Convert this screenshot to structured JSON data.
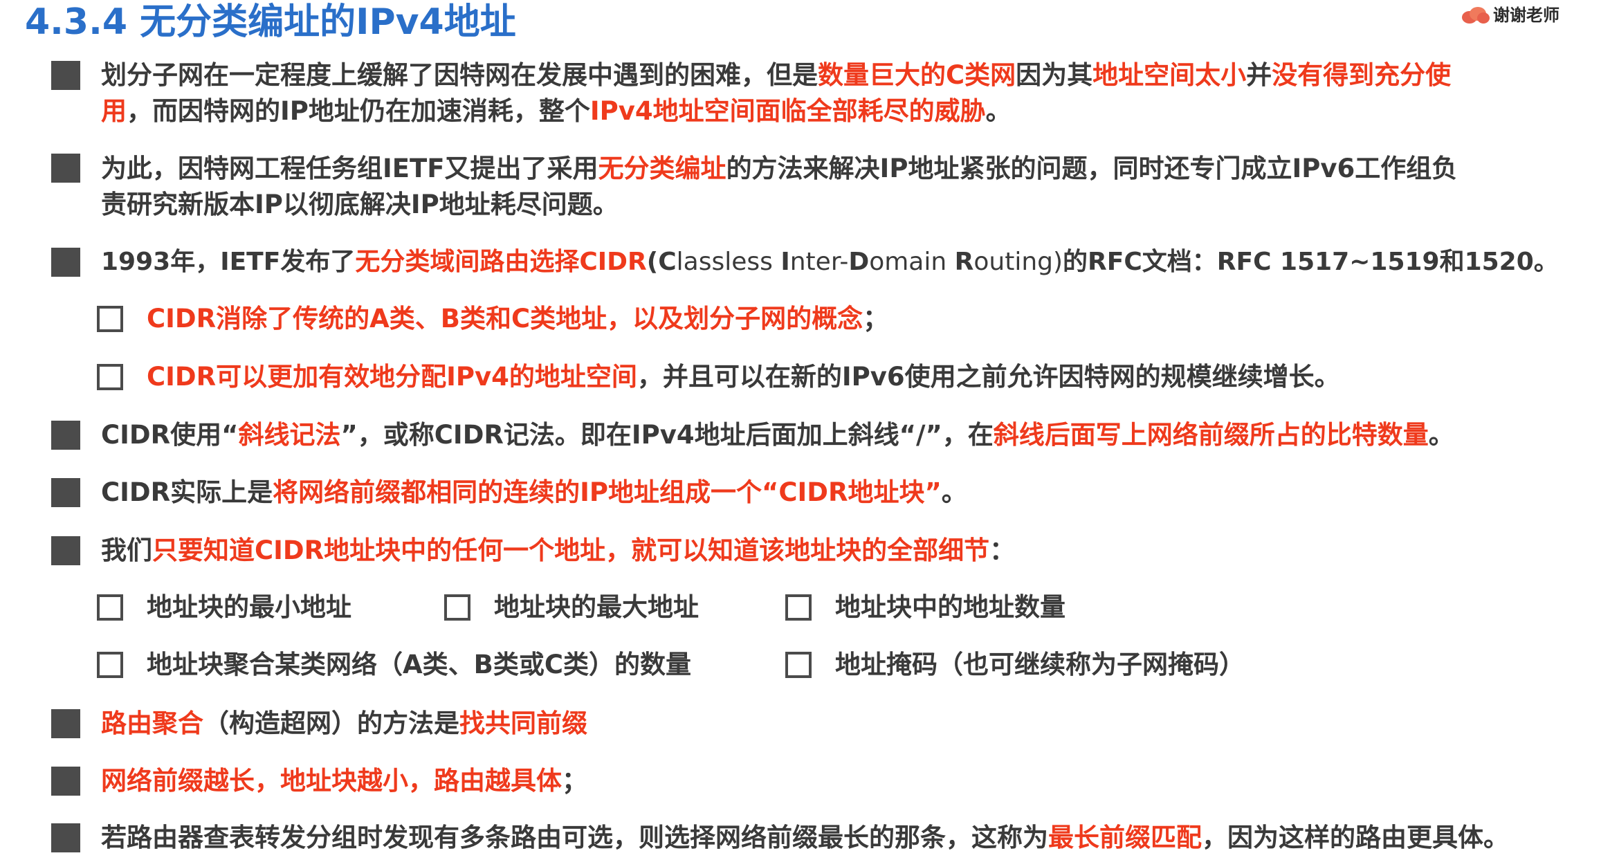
{
  "title": "4.3.4 无分类编址的IPv4地址",
  "logo": "谢谢老师",
  "b1": {
    "l1": [
      "划分子网在一定程度上缓解了因特网在发展中遇到的困难，但是",
      "数量巨大的C类网",
      "因为其",
      "地址空间太小",
      "并",
      "没有得到充分使"
    ],
    "l2": [
      "用",
      "，而因特网的IP地址仍在加速消耗，整个",
      "IPv4地址空间面临全部耗尽的威胁",
      "。"
    ]
  },
  "b2": {
    "l1": [
      "为此，因特网工程任务组IETF又提出了采用",
      "无分类编址",
      "的方法来解决IP地址紧张的问题，同时还专门成立IPv6工作组负"
    ],
    "l2": [
      "责研究新版本IP以彻底解决IP地址耗尽问题。"
    ]
  },
  "b3": [
    "1993年，IETF发布了",
    "无分类域间路由选择CIDR",
    "(",
    "C",
    "lassless ",
    "I",
    "nter-",
    "D",
    "omain ",
    "R",
    "outing)",
    "的RFC文档：RFC 1517~1519和1520。"
  ],
  "s1": [
    "CIDR消除了传统的A类、B类和C类地址，以及划分子网的概念",
    "；"
  ],
  "s2": [
    "CIDR可以更加有效地分配IPv4的地址空间",
    "，并且可以在新的IPv6使用之前允许因特网的规模继续增长。"
  ],
  "b4": [
    "CIDR使用“",
    "斜线记法",
    "”，或称CIDR记法。即在IPv4地址后面加上斜线“/”，在",
    "斜线后面写上网络前缀所占的比特数量",
    "。"
  ],
  "b5": [
    "CIDR实际上是",
    "将网络前缀都相同的连续的IP地址组成一个“CIDR地址块”",
    "。"
  ],
  "b6": [
    "我们",
    "只要知道CIDR地址块中的任何一个地址，就可以知道该地址块的全部细节",
    "："
  ],
  "opts": {
    "o1": "地址块的最小地址",
    "o2": "地址块的最大地址",
    "o3": "地址块中的地址数量",
    "o4": "地址块聚合某类网络（A类、B类或C类）的数量",
    "o5": "地址掩码（也可继续称为子网掩码）"
  },
  "b7": [
    "路由聚合",
    "（构造超网）的方法是",
    "找共同前缀"
  ],
  "b8": [
    "网络前缀越长，地址块越小，路由越具体",
    "；"
  ],
  "b9": [
    "若路由器查表转发分组时发现有多条路由可选，则选择网络前缀最长的那条，这称为",
    "最长前缀匹配",
    "，因为这样的路由更具体。"
  ],
  "colors": {
    "title": "#2a6fc9",
    "highlight": "#ef3a1c",
    "text": "#3a3a3a",
    "bullet": "#4b4b4b"
  }
}
